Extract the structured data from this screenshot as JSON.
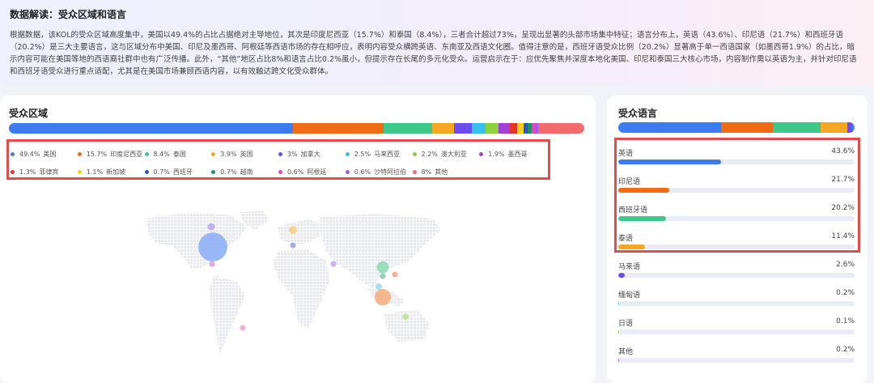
{
  "summary": {
    "title": "数据解读：受众区域和语言",
    "text": "根据数据，该KOL的受众区域高度集中，美国以49.4%的占比占据绝对主导地位，其次是印度尼西亚（15.7%）和泰国（8.4%），三者合计超过73%，呈现出显著的头部市场集中特征；语言分布上，英语（43.6%）、印尼语（21.7%）和西班牙语（20.2%）是三大主要语言，这与区域分布中美国、印尼及墨西哥、阿根廷等西语市场的存在相呼应，表明内容受众横跨英语、东南亚及西语文化圈。值得注意的是，西班牙语受众比例（20.2%）显著高于单一西语国家（如墨西哥1.9%）的占比，暗示内容可能在美国等地的西语裔社群中也有广泛传播。此外，“其他”地区占比8%和语言占比0.2%虽小，但提示存在长尾的多元化受众。运营启示在于：应优先聚焦并深度本地化美国、印尼和泰国三大核心市场，内容制作需以英语为主，并针对印尼语和西班牙语受众进行重点适配，尤其是在美国市场兼顾西语内容，以有效触达跨文化受众群体。"
  },
  "region": {
    "title": "受众区域",
    "items": [
      {
        "value": "49.4%",
        "pct": 49.4,
        "label": "美国",
        "color": "#3d7cf0"
      },
      {
        "value": "15.7%",
        "pct": 15.7,
        "label": "印度尼西亚",
        "color": "#f06c14"
      },
      {
        "value": "8.4%",
        "pct": 8.4,
        "label": "泰国",
        "color": "#3ec98a"
      },
      {
        "value": "3.9%",
        "pct": 3.9,
        "label": "英国",
        "color": "#f5a623"
      },
      {
        "value": "3%",
        "pct": 3.0,
        "label": "加拿大",
        "color": "#6a4ff0"
      },
      {
        "value": "2.5%",
        "pct": 2.5,
        "label": "马来西亚",
        "color": "#37c0ee"
      },
      {
        "value": "2.2%",
        "pct": 2.2,
        "label": "澳大利亚",
        "color": "#8bd13c"
      },
      {
        "value": "1.9%",
        "pct": 1.9,
        "label": "墨西哥",
        "color": "#a43fd6"
      },
      {
        "value": "1.3%",
        "pct": 1.3,
        "label": "菲律宾",
        "color": "#e6332a"
      },
      {
        "value": "1.1%",
        "pct": 1.1,
        "label": "新加坡",
        "color": "#f3d11a"
      },
      {
        "value": "0.7%",
        "pct": 0.7,
        "label": "西班牙",
        "color": "#2855c7"
      },
      {
        "value": "0.7%",
        "pct": 0.7,
        "label": "越南",
        "color": "#1f8f5e"
      },
      {
        "value": "0.6%",
        "pct": 0.6,
        "label": "阿根廷",
        "color": "#e846c0"
      },
      {
        "value": "0.6%",
        "pct": 0.6,
        "label": "沙特阿拉伯",
        "color": "#9d5cf0"
      },
      {
        "value": "8%",
        "pct": 8.0,
        "label": "其他",
        "color": "#f26b6b"
      }
    ]
  },
  "language": {
    "title": "受众语言",
    "items": [
      {
        "label": "英语",
        "value": "43.6%",
        "pct": 43.6,
        "color": "#3d7cf0"
      },
      {
        "label": "印尼语",
        "value": "21.7%",
        "pct": 21.7,
        "color": "#f06c14"
      },
      {
        "label": "西班牙语",
        "value": "20.2%",
        "pct": 20.2,
        "color": "#3ec98a"
      },
      {
        "label": "泰语",
        "value": "11.4%",
        "pct": 11.4,
        "color": "#f5a623"
      },
      {
        "label": "马来语",
        "value": "2.6%",
        "pct": 2.6,
        "color": "#6a4ff0"
      },
      {
        "label": "缅甸语",
        "value": "0.2%",
        "pct": 0.2,
        "color": "#37c0ee"
      },
      {
        "label": "日语",
        "value": "0.1%",
        "pct": 0.1,
        "color": "#8bd13c"
      },
      {
        "label": "其他",
        "value": "0.2%",
        "pct": 0.2,
        "color": "#a43fd6"
      }
    ]
  },
  "map_bubbles": [
    {
      "country": "美国",
      "color": "#8fb0f5"
    },
    {
      "country": "加拿大",
      "color": "#b9a8f5"
    },
    {
      "country": "墨西哥",
      "color": "#e59ae0"
    },
    {
      "country": "英国",
      "color": "#f8d08a"
    },
    {
      "country": "西班牙",
      "color": "#9aa6e6"
    },
    {
      "country": "沙特阿拉伯",
      "color": "#c6a8f3"
    },
    {
      "country": "泰国",
      "color": "#8fdbb7"
    },
    {
      "country": "越南",
      "color": "#90c7ad"
    },
    {
      "country": "菲律宾",
      "color": "#f4a58f"
    },
    {
      "country": "马来西亚",
      "color": "#9bdcf2"
    },
    {
      "country": "新加坡",
      "color": "#f4e38c"
    },
    {
      "country": "印度尼西亚",
      "color": "#f5b083"
    },
    {
      "country": "澳大利亚",
      "color": "#bfe29a"
    },
    {
      "country": "阿根廷",
      "color": "#eeaad8"
    }
  ]
}
